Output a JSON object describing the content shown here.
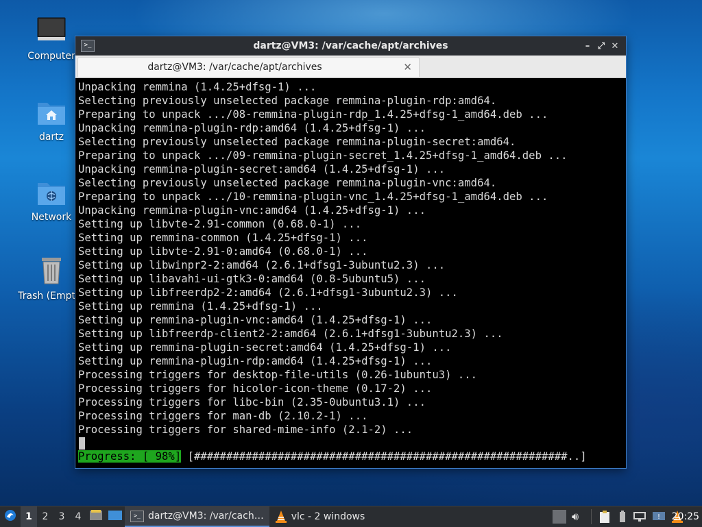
{
  "desktop": {
    "icons": [
      {
        "label": "Computer",
        "icon": "computer-icon"
      },
      {
        "label": "dartz",
        "icon": "home-folder-icon"
      },
      {
        "label": "Network",
        "icon": "network-folder-icon"
      },
      {
        "label": "Trash (Empty)",
        "icon": "trash-icon"
      }
    ]
  },
  "window": {
    "title": "dartz@VM3: /var/cache/apt/archives",
    "controls": {
      "minimize": "–",
      "maximize": "⤢",
      "close": "✕"
    },
    "tab": {
      "label": "dartz@VM3: /var/cache/apt/archives",
      "close": "✕"
    }
  },
  "terminal": {
    "lines": [
      "Unpacking remmina (1.4.25+dfsg-1) ...",
      "Selecting previously unselected package remmina-plugin-rdp:amd64.",
      "Preparing to unpack .../08-remmina-plugin-rdp_1.4.25+dfsg-1_amd64.deb ...",
      "Unpacking remmina-plugin-rdp:amd64 (1.4.25+dfsg-1) ...",
      "Selecting previously unselected package remmina-plugin-secret:amd64.",
      "Preparing to unpack .../09-remmina-plugin-secret_1.4.25+dfsg-1_amd64.deb ...",
      "Unpacking remmina-plugin-secret:amd64 (1.4.25+dfsg-1) ...",
      "Selecting previously unselected package remmina-plugin-vnc:amd64.",
      "Preparing to unpack .../10-remmina-plugin-vnc_1.4.25+dfsg-1_amd64.deb ...",
      "Unpacking remmina-plugin-vnc:amd64 (1.4.25+dfsg-1) ...",
      "Setting up libvte-2.91-common (0.68.0-1) ...",
      "Setting up remmina-common (1.4.25+dfsg-1) ...",
      "Setting up libvte-2.91-0:amd64 (0.68.0-1) ...",
      "Setting up libwinpr2-2:amd64 (2.6.1+dfsg1-3ubuntu2.3) ...",
      "Setting up libavahi-ui-gtk3-0:amd64 (0.8-5ubuntu5) ...",
      "Setting up libfreerdp2-2:amd64 (2.6.1+dfsg1-3ubuntu2.3) ...",
      "Setting up remmina (1.4.25+dfsg-1) ...",
      "Setting up remmina-plugin-vnc:amd64 (1.4.25+dfsg-1) ...",
      "Setting up libfreerdp-client2-2:amd64 (2.6.1+dfsg1-3ubuntu2.3) ...",
      "Setting up remmina-plugin-secret:amd64 (1.4.25+dfsg-1) ...",
      "Setting up remmina-plugin-rdp:amd64 (1.4.25+dfsg-1) ...",
      "Processing triggers for desktop-file-utils (0.26-1ubuntu3) ...",
      "Processing triggers for hicolor-icon-theme (0.17-2) ...",
      "Processing triggers for libc-bin (2.35-0ubuntu3.1) ...",
      "Processing triggers for man-db (2.10.2-1) ...",
      "Processing triggers for shared-mime-info (2.1-2) ..."
    ],
    "progress_label": "Progress: [ 98%]",
    "progress_bar": "[##########################################################..]"
  },
  "taskbar": {
    "workspaces": [
      "1",
      "2",
      "3",
      "4"
    ],
    "active_workspace": "1",
    "tasks": [
      {
        "label": "dartz@VM3: /var/cach…",
        "icon": "terminal-icon",
        "active": true
      },
      {
        "label": "vlc - 2 windows",
        "icon": "vlc-icon",
        "active": false
      }
    ],
    "clock": "20:25"
  },
  "colors": {
    "progress_green": "#1ea61e",
    "panel": "#2a2d31",
    "titlebar": "#2b2e33"
  }
}
